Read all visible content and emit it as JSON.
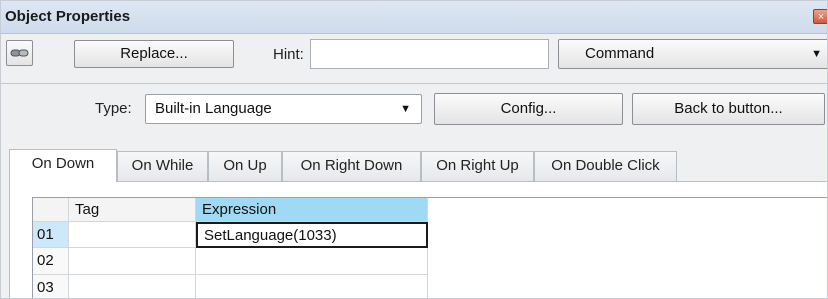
{
  "window": {
    "title": "Object Properties",
    "close_glyph": "×"
  },
  "toolbar": {
    "icon": "chain-link-icon",
    "replace_label": "Replace...",
    "hint_label": "Hint:",
    "hint_value": "",
    "command_value": "Command"
  },
  "type_row": {
    "type_label": "Type:",
    "type_value": "Built-in Language",
    "config_label": "Config...",
    "back_label": "Back to button..."
  },
  "tabs": [
    {
      "label": "On Down",
      "active": true
    },
    {
      "label": "On While",
      "active": false
    },
    {
      "label": "On Up",
      "active": false
    },
    {
      "label": "On Right Down",
      "active": false
    },
    {
      "label": "On Right Up",
      "active": false
    },
    {
      "label": "On Double Click",
      "active": false
    }
  ],
  "grid": {
    "columns": [
      "Tag",
      "Expression"
    ],
    "rows": [
      {
        "num": "01",
        "tag": "",
        "expression": "SetLanguage(1033)"
      },
      {
        "num": "02",
        "tag": "",
        "expression": ""
      },
      {
        "num": "03",
        "tag": "",
        "expression": ""
      }
    ]
  },
  "colors": {
    "selected_header": "#9fd9f4",
    "selected_rownum": "#cde8fb",
    "titlebar": "#d5e0ef"
  }
}
